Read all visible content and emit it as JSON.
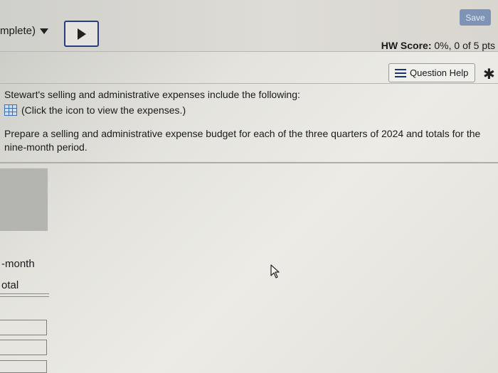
{
  "header": {
    "save_label": "Save",
    "status_label": "mplete)",
    "hw_score_label": "HW Score:",
    "hw_score_value": "0%, 0 of 5 pts"
  },
  "toolbar": {
    "question_help_label": "Question Help"
  },
  "question": {
    "line1": "Stewart's selling and administrative expenses include the following:",
    "line2": "(Click the icon to view the expenses.)",
    "prompt": "Prepare a selling and administrative expense budget for each of the three quarters of 2024 and totals for the nine-month period."
  },
  "table": {
    "column_label_1": "-month",
    "column_label_2": "otal"
  },
  "icons": {
    "status_dropdown": "caret-down-icon",
    "next_button": "play-icon",
    "question_help": "list-icon",
    "settings": "gear-icon",
    "expenses": "table-grid-icon",
    "cursor": "mouse-pointer-icon"
  }
}
